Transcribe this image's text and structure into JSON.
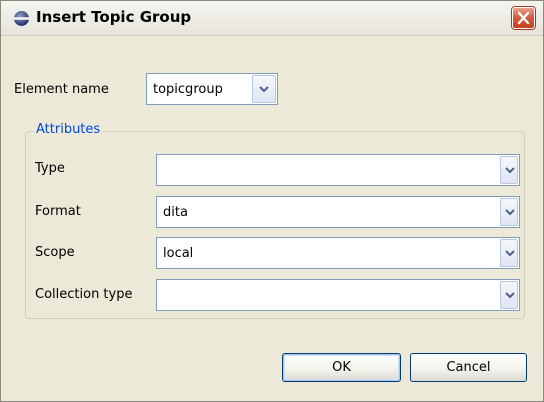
{
  "window": {
    "title": "Insert Topic Group"
  },
  "element": {
    "label": "Element name",
    "value": "topicgroup"
  },
  "attributes": {
    "legend": "Attributes",
    "fields": [
      {
        "label": "Type",
        "value": ""
      },
      {
        "label": "Format",
        "value": "dita"
      },
      {
        "label": "Scope",
        "value": "local"
      },
      {
        "label": "Collection type",
        "value": ""
      }
    ]
  },
  "buttons": {
    "ok": "OK",
    "cancel": "Cancel"
  },
  "icons": {
    "app": "globe-icon",
    "close": "close-icon",
    "dropdown": "chevron-down-icon"
  },
  "colors": {
    "legend": "#0046d5",
    "close_button": "#d6583c",
    "dialog_bg": "#ece9d8"
  }
}
